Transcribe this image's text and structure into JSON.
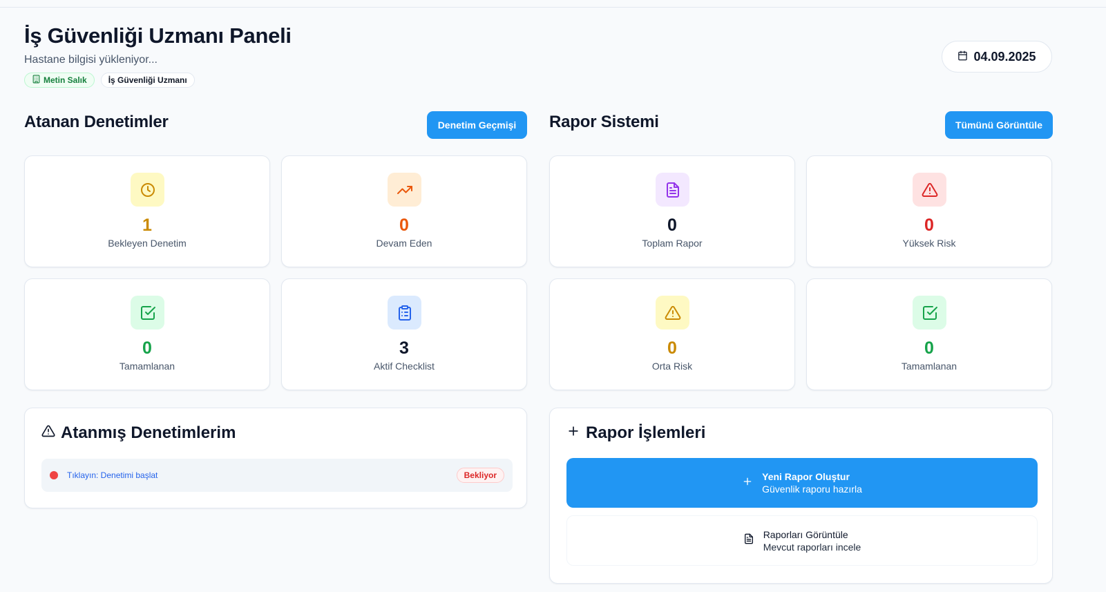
{
  "header": {
    "title": "İş Güvenliği Uzmanı Paneli",
    "subtitle": "Hastane bilgisi yükleniyor...",
    "user_badge": "Metin Salık",
    "role_badge": "İş Güvenliği Uzmanı",
    "date": "04.09.2025"
  },
  "audits": {
    "title": "Atanan Denetimler",
    "history_button": "Denetim Geçmişi",
    "stats": [
      {
        "value": "1",
        "label": "Bekleyen Denetim",
        "icon": "clock-icon",
        "color": "#ca8a04",
        "bg": "#fef9c3"
      },
      {
        "value": "0",
        "label": "Devam Eden",
        "icon": "trending-up-icon",
        "color": "#ea580c",
        "bg": "#ffedd5"
      },
      {
        "value": "0",
        "label": "Tamamlanan",
        "icon": "check-square-icon",
        "color": "#16a34a",
        "bg": "#dcfce7"
      },
      {
        "value": "3",
        "label": "Aktif Checklist",
        "icon": "clipboard-icon",
        "color": "#0f172a",
        "bg": "#dbeafe"
      }
    ]
  },
  "reports": {
    "title": "Rapor Sistemi",
    "view_all_button": "Tümünü Görüntüle",
    "stats": [
      {
        "value": "0",
        "label": "Toplam Rapor",
        "icon": "file-text-icon",
        "color": "#0f172a",
        "bg": "#f3e8ff"
      },
      {
        "value": "0",
        "label": "Yüksek Risk",
        "icon": "alert-triangle-icon",
        "color": "#dc2626",
        "bg": "#fee2e2"
      },
      {
        "value": "0",
        "label": "Orta Risk",
        "icon": "alert-triangle-icon",
        "color": "#ca8a04",
        "bg": "#fef9c3"
      },
      {
        "value": "0",
        "label": "Tamamlanan",
        "icon": "check-square-icon",
        "color": "#16a34a",
        "bg": "#dcfce7"
      }
    ]
  },
  "assigned_panel": {
    "title": "Atanmış Denetimlerim",
    "items": [
      {
        "link": "Tıklayın: Denetimi başlat",
        "status": "Bekliyor"
      }
    ]
  },
  "report_actions": {
    "title": "Rapor İşlemleri",
    "new_report": {
      "title": "Yeni Rapor Oluştur",
      "subtitle": "Güvenlik raporu hazırla"
    },
    "view_reports": {
      "title": "Raporları Görüntüle",
      "subtitle": "Mevcut raporları incele"
    }
  }
}
